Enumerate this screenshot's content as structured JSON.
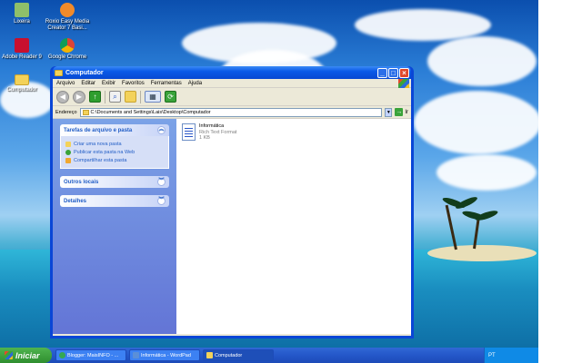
{
  "desktop": {
    "icons": [
      {
        "label": "Lixeira",
        "icon": "recycle-bin-icon",
        "color": "#8fbf6a"
      },
      {
        "label": "Roxio Easy Media Creator 7 Basi...",
        "icon": "roxio-icon",
        "color": "#f08a2a"
      },
      {
        "label": "Adobe Reader 9",
        "icon": "adobe-reader-icon",
        "color": "#c8102e"
      },
      {
        "label": "Google Chrome",
        "icon": "chrome-icon",
        "color": "#34a853"
      },
      {
        "label": "Computador",
        "icon": "folder-icon",
        "color": "#f3d25a"
      }
    ]
  },
  "window": {
    "title": "Computador",
    "menu": [
      "Arquivo",
      "Editar",
      "Exibir",
      "Favoritos",
      "Ferramentas",
      "Ajuda"
    ],
    "toolbar": {
      "back": "◀",
      "forward": "▶",
      "up": "↑",
      "search": "⌕",
      "folders": "",
      "views": "▦",
      "sync": "⟳"
    },
    "address": {
      "label": "Endereço",
      "value": "C:\\Documents and Settings\\Lais\\Desktop\\Computador",
      "go_label": "Ir",
      "go_icon": "→"
    },
    "taskpane": {
      "groups": [
        {
          "title": "Tarefas de arquivo e pasta",
          "expanded": true,
          "tasks": [
            {
              "label": "Criar uma nova pasta",
              "icon": "new-folder-icon",
              "color": "#f3d25a"
            },
            {
              "label": "Publicar esta pasta na Web",
              "icon": "publish-web-icon",
              "color": "#3aa33a"
            },
            {
              "label": "Compartilhar esta pasta",
              "icon": "share-folder-icon",
              "color": "#f0a830"
            }
          ]
        },
        {
          "title": "Outros locais",
          "expanded": false,
          "tasks": []
        },
        {
          "title": "Detalhes",
          "expanded": false,
          "tasks": []
        }
      ]
    },
    "files": [
      {
        "name": "Informática",
        "type": "Rich Text Format",
        "size": "1 KB",
        "icon": "wordpad-document-icon"
      }
    ]
  },
  "taskbar": {
    "start_label": "Iniciar",
    "tasks": [
      {
        "label": "Blogger: MaisINFO - ...",
        "icon": "chrome-icon",
        "color": "#34a853",
        "active": false
      },
      {
        "label": "Informática - WordPad",
        "icon": "wordpad-icon",
        "color": "#5b8fd8",
        "active": false
      },
      {
        "label": "Computador",
        "icon": "folder-icon",
        "color": "#f3d25a",
        "active": true
      }
    ],
    "tray_language": "PT"
  }
}
